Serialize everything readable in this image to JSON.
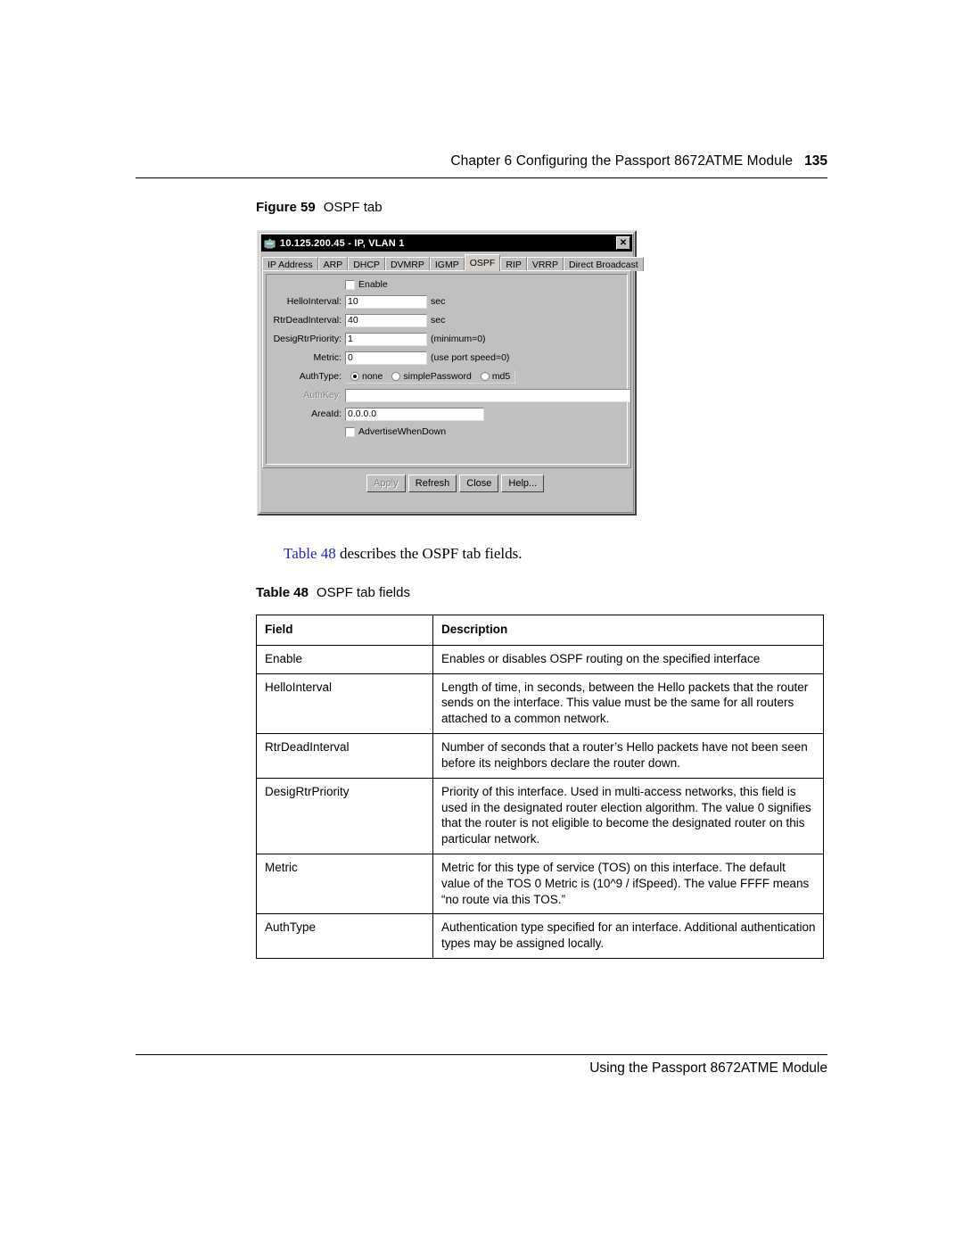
{
  "header": {
    "chapter_text": "Chapter 6  Configuring the Passport 8672ATME Module",
    "page_number": "135"
  },
  "figure": {
    "label": "Figure 59",
    "title": "OSPF tab"
  },
  "dialog": {
    "icon": "device-icon",
    "title": "10.125.200.45 - IP, VLAN 1",
    "close_label": "✕",
    "tabs": [
      {
        "label": "IP Address",
        "selected": false
      },
      {
        "label": "ARP",
        "selected": false
      },
      {
        "label": "DHCP",
        "selected": false
      },
      {
        "label": "DVMRP",
        "selected": false
      },
      {
        "label": "IGMP",
        "selected": false
      },
      {
        "label": "OSPF",
        "selected": true
      },
      {
        "label": "RIP",
        "selected": false
      },
      {
        "label": "VRRP",
        "selected": false
      },
      {
        "label": "Direct Broadcast",
        "selected": false
      }
    ],
    "form": {
      "enable": {
        "label": "Enable",
        "checked": false
      },
      "hello_interval": {
        "label": "HelloInterval:",
        "value": "10",
        "suffix": "sec"
      },
      "rtr_dead_interval": {
        "label": "RtrDeadInterval:",
        "value": "40",
        "suffix": "sec"
      },
      "desig_rtr_priority": {
        "label": "DesigRtrPriority:",
        "value": "1",
        "suffix": "(minimum=0)"
      },
      "metric": {
        "label": "Metric:",
        "value": "0",
        "suffix": "(use port speed=0)"
      },
      "auth_type": {
        "label": "AuthType:",
        "options": [
          "none",
          "simplePassword",
          "md5"
        ],
        "selected": "none"
      },
      "auth_key": {
        "label": "AuthKey:",
        "value": "",
        "disabled": true
      },
      "area_id": {
        "label": "AreaId:",
        "value": "0.0.0.0"
      },
      "advertise_when_down": {
        "label": "AdvertiseWhenDown",
        "checked": false
      }
    },
    "buttons": [
      {
        "label": "Apply",
        "disabled": true
      },
      {
        "label": "Refresh",
        "disabled": false
      },
      {
        "label": "Close",
        "disabled": false
      },
      {
        "label": "Help...",
        "disabled": false
      }
    ]
  },
  "body": {
    "xref": "Table 48",
    "paragraph_rest": " describes the OSPF tab fields."
  },
  "table": {
    "label": "Table 48",
    "title": "OSPF tab fields",
    "columns": [
      "Field",
      "Description"
    ],
    "rows": [
      {
        "field": "Enable",
        "description": "Enables or disables OSPF routing on the specified interface"
      },
      {
        "field": "HelloInterval",
        "description": "Length of time, in seconds, between the Hello packets that the router sends on the interface. This value must be the same for all routers attached to a common network."
      },
      {
        "field": "RtrDeadInterval",
        "description": "Number of seconds that a router’s Hello packets have not been seen before its neighbors declare the router down."
      },
      {
        "field": "DesigRtrPriority",
        "description": "Priority of this interface. Used in multi-access networks, this field is used in the designated router election algorithm. The value 0 signifies that the router is not eligible to become the designated router on this particular network."
      },
      {
        "field": "Metric",
        "description": "Metric for this type of service (TOS) on this interface. The default value of the TOS 0 Metric is (10^9 / ifSpeed). The value FFFF means “no route via this TOS.”"
      },
      {
        "field": "AuthType",
        "description": "Authentication type specified for an interface. Additional authentication types may be assigned locally."
      }
    ]
  },
  "footer": {
    "text": "Using the Passport 8672ATME Module"
  },
  "colors": {
    "xref_link": "#2222cc",
    "dialog_face": "#c0c0c0",
    "titlebar": "#000000"
  }
}
